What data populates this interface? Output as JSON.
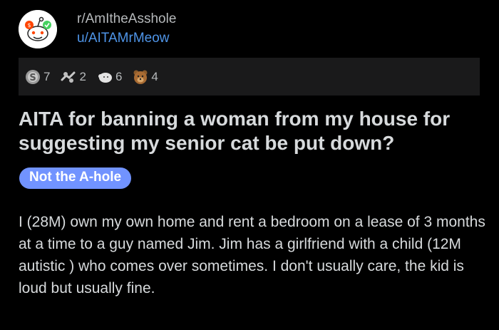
{
  "post": {
    "subreddit": "r/AmItheAsshole",
    "author": "u/AITAMrMeow",
    "awards": [
      {
        "icon": "silver-award-icon",
        "count": "7"
      },
      {
        "icon": "helpful-award-icon",
        "count": "2"
      },
      {
        "icon": "wholesome-award-icon",
        "count": "6"
      },
      {
        "icon": "bear-award-icon",
        "count": "4"
      }
    ],
    "title": "AITA for banning a woman from my house for suggesting my senior cat be put down?",
    "flair": "Not the A-hole",
    "body": "I (28M) own my own home and rent a bedroom on a lease of 3 months at a time to a guy named Jim.  Jim has a girlfriend with a child (12M autistic ) who comes over sometimes.  I don't usually care, the kid is loud but usually fine."
  },
  "colors": {
    "background": "#000000",
    "text": "#d7dadc",
    "username": "#4f95e8",
    "flair_bg": "#7193ff",
    "awards_bar": "#1a1a1b"
  }
}
